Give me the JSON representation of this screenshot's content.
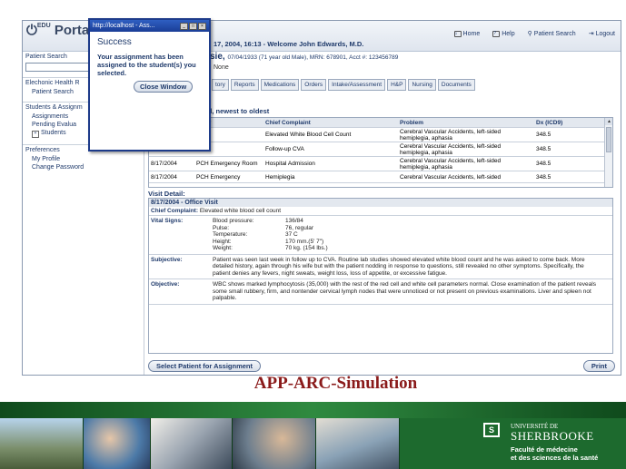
{
  "app": {
    "logo_text": "EDU",
    "logo_word": "Porta",
    "header_line": "17, 2004, 16:13 - Welcome John Edwards, M.D.",
    "patient_name": "sie,",
    "patient_info": "07/04/1933 (71 year old Male), MRN: 678901, Acct #: 123456789",
    "none_label": "None"
  },
  "topnav": {
    "home": "Home",
    "help": "Help",
    "patient_search": "Patient Search",
    "logout": "Logout"
  },
  "sidebar": {
    "patient_search_label": "Patient Search",
    "section1": "Elechonic Health R",
    "patient_search_item": "Patient Search",
    "section2": "Students & Assignm",
    "assignments": "Assignments",
    "pending": "Pending Evalua",
    "students": "Students",
    "section3": "Preferences",
    "my_profile": "My Profile",
    "change_password": "Change Password"
  },
  "tabs": [
    "tory",
    "Reports",
    "Medications",
    "Orders",
    "Intake/Assessment",
    "H&P",
    "Nursing",
    "Documents"
  ],
  "visits": {
    "sort_label": "all, newest to oldest",
    "headers": [
      "",
      "unter",
      "Chief Complaint",
      "Problem",
      "Dx (ICD9)"
    ],
    "rows": [
      [
        "",
        "Visit",
        "Elevated White Blood Cell Count",
        "Cerebral Vascular Accidents, left-sided hemiplegia, aphasia",
        "348.5"
      ],
      [
        "",
        "Visit",
        "Follow-up CVA",
        "Cerebral Vascular Accidents, left-sided hemiplegia, aphasia",
        "348.5"
      ],
      [
        "8/17/2004",
        "PCH Emergency Room",
        "Hospital Admission",
        "Cerebral Vascular Accidents, left-sided hemiplegia, aphasia",
        "348.5"
      ],
      [
        "8/17/2004",
        "PCH Emergency",
        "Hemiplegia",
        "Cerebral Vascular Accidents, left-sided",
        "348.5"
      ]
    ]
  },
  "visit_detail": {
    "label": "Visit Detail:",
    "title": "8/17/2004 - Office Visit",
    "cc_label": "Chief Complaint:",
    "cc_value": "Elevated white blood cell count",
    "vitals_label": "Vital Signs:",
    "vitals": [
      [
        "Blood pressure:",
        "136/84"
      ],
      [
        "Pulse:",
        "76, regular"
      ],
      [
        "Temperature:",
        "37 C"
      ],
      [
        "Height:",
        "170 mm.(5' 7\")"
      ],
      [
        "Weight:",
        "70 kg. (154 lbs.)"
      ]
    ],
    "subjective_label": "Subjective:",
    "subjective_text": "Patient was seen last week in follow up to CVA. Routine lab studies showed elevated white blood count and he was asked to come back. More detailed history, again through his wife but with the patient nodding in response to questions, still revealed no other symptoms. Specifically, the patient denies any fevers, night sweats, weight loss, loss of appetite, or excessive fatigue.",
    "objective_label": "Objective:",
    "objective_text": "WBC shows marked lymphocytosis (35,000) with the rest of the red cell and white cell parameters normal. Close examination of the patient reveals some small rubbery, firm, and nontender cervical lymph nodes that were unnoticed or not present on previous examinations. Liver and spleen not palpable."
  },
  "buttons": {
    "select_patient": "Select Patient for Assignment",
    "print": "Print"
  },
  "popup": {
    "title": "http://localhost - Ass...",
    "heading": "Success",
    "message": "Your assignment has been assigned to the student(s) you selected.",
    "close_btn": "Close Window"
  },
  "slide": {
    "title": "APP-ARC-Simulation"
  },
  "footer": {
    "uni_de": "UNIVERSITÉ DE",
    "uni_name": "SHERBROOKE",
    "fac_line1": "Faculté de médecine",
    "fac_line2": "et des sciences de la santé",
    "logo_mark": "S"
  },
  "colors": {
    "title_red": "#8a1a1a",
    "nav_blue": "#1f3a6b",
    "footer_green": "#1d6a2e",
    "popup_title_blue": "#1a3d96"
  }
}
